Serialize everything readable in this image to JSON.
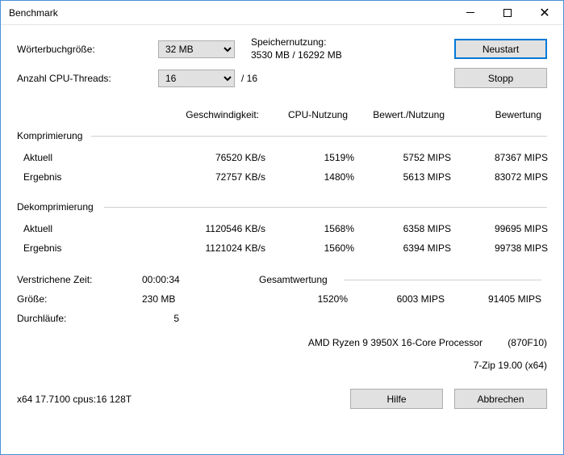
{
  "window": {
    "title": "Benchmark"
  },
  "labels": {
    "dictSize": "Wörterbuchgröße:",
    "threads": "Anzahl CPU-Threads:",
    "memUsage": "Speichernutzung:",
    "threadsMax": "/ 16"
  },
  "selects": {
    "dictSize": "32 MB",
    "threads": "16"
  },
  "memory": "3530 MB / 16292 MB",
  "buttons": {
    "restart": "Neustart",
    "stop": "Stopp",
    "help": "Hilfe",
    "cancel": "Abbrechen"
  },
  "headers": {
    "speed": "Geschwindigkeit:",
    "cpu": "CPU-Nutzung",
    "ratio": "Bewert./Nutzung",
    "rating": "Bewertung"
  },
  "compress": {
    "title": "Komprimierung",
    "rows": {
      "current": {
        "label": "Aktuell",
        "speed": "76520 KB/s",
        "cpu": "1519%",
        "ratio": "5752 MIPS",
        "rating": "87367 MIPS"
      },
      "result": {
        "label": "Ergebnis",
        "speed": "72757 KB/s",
        "cpu": "1480%",
        "ratio": "5613 MIPS",
        "rating": "83072 MIPS"
      }
    }
  },
  "decompress": {
    "title": "Dekomprimierung",
    "rows": {
      "current": {
        "label": "Aktuell",
        "speed": "1120546 KB/s",
        "cpu": "1568%",
        "ratio": "6358 MIPS",
        "rating": "99695 MIPS"
      },
      "result": {
        "label": "Ergebnis",
        "speed": "1121024 KB/s",
        "cpu": "1560%",
        "ratio": "6394 MIPS",
        "rating": "99738 MIPS"
      }
    }
  },
  "footer": {
    "elapsedLabel": "Verstrichene Zeit:",
    "elapsed": "00:00:34",
    "sizeLabel": "Größe:",
    "size": "230 MB",
    "passesLabel": "Durchläufe:",
    "passes": "5",
    "overallLabel": "Gesamtwertung",
    "overall": {
      "cpu": "1520%",
      "ratio": "6003 MIPS",
      "rating": "91405 MIPS"
    }
  },
  "cpu": {
    "name": "AMD Ryzen 9 3950X 16-Core Processor",
    "id": "(870F10)"
  },
  "version": "7-Zip 19.00 (x64)",
  "build": "x64 17.7100 cpus:16 128T"
}
